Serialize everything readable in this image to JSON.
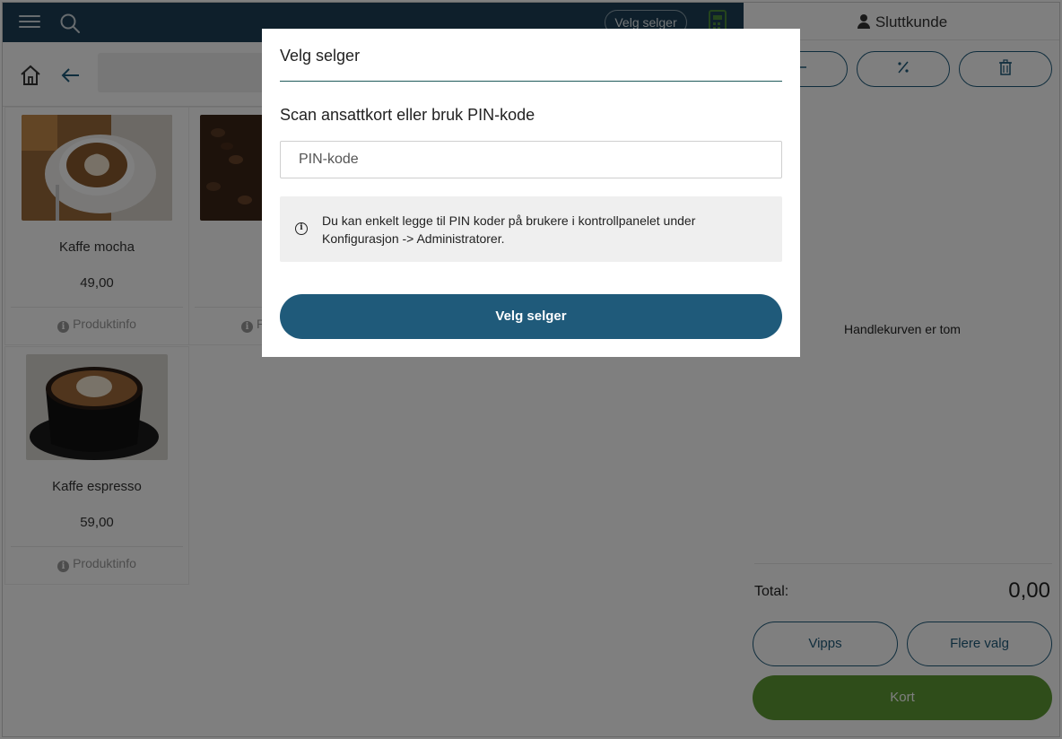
{
  "topbar": {
    "seller_label": "Velg selger"
  },
  "products": [
    {
      "name": "Kaffe mocha",
      "price": "49,00",
      "info": "Produktinfo"
    },
    {
      "name": "",
      "price": "",
      "info": "P"
    },
    {
      "name": "Kaffe espresso",
      "price": "59,00",
      "info": "Produktinfo"
    }
  ],
  "cart": {
    "customer": "Sluttkunde",
    "action_icons": [
      "minus-icon",
      "percent-icon",
      "trash-icon"
    ],
    "empty_text": "Handlekurven er tom",
    "total_label": "Total:",
    "total_value": "0,00",
    "pay_buttons": [
      "Vipps",
      "Flere valg"
    ],
    "card_button": "Kort"
  },
  "modal": {
    "title": "Velg selger",
    "subtitle": "Scan ansattkort eller bruk PIN-kode",
    "pin_placeholder": "PIN-kode",
    "pin_value": "",
    "notice": "Du kan enkelt legge til PIN koder på brukere i kontrollpanelet under Konfigurasjon -> Administratorer.",
    "confirm_button": "Velg selger"
  },
  "colors": {
    "topbar": "#1c3f57",
    "primary": "#1f5a7a",
    "green": "#5e9a35"
  }
}
